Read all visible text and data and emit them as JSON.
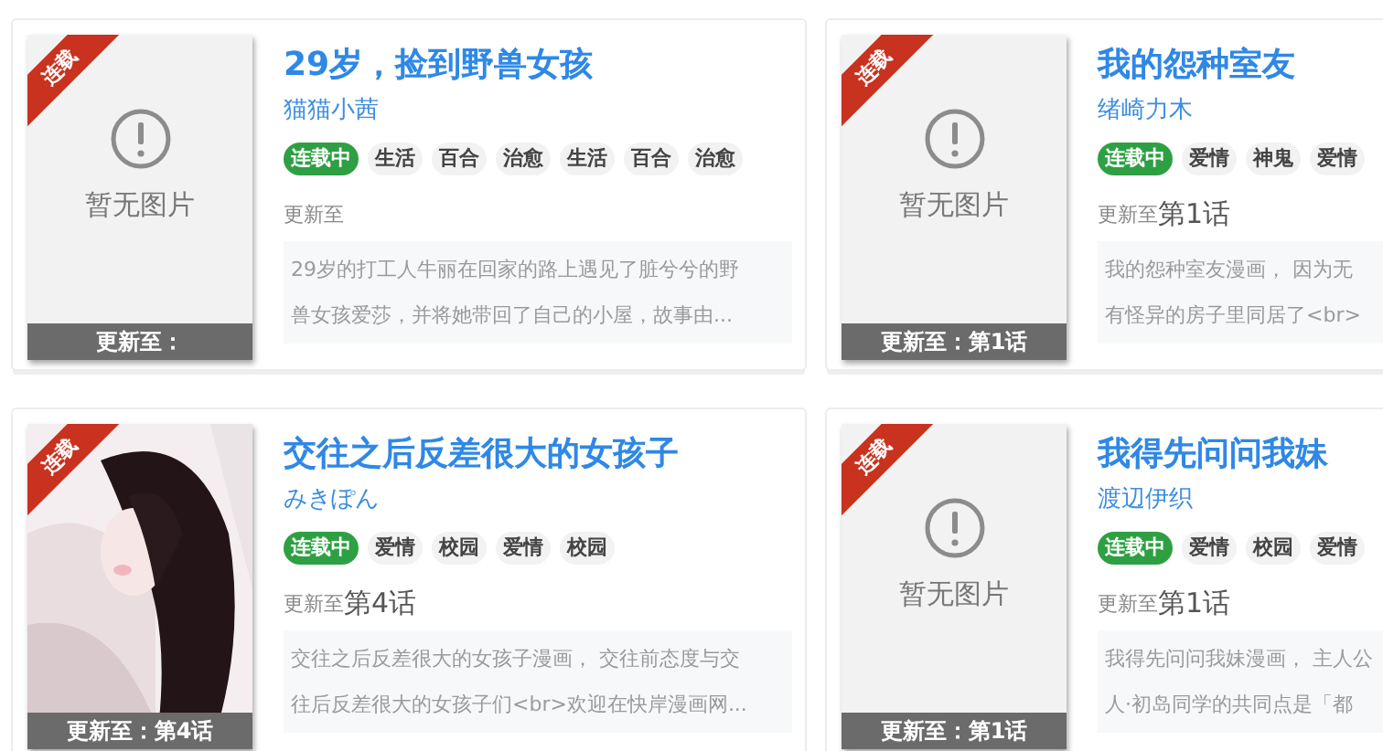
{
  "cards": [
    {
      "title": "29岁，捡到野兽女孩",
      "author": "猫猫小茜",
      "ribbon": "连载",
      "cover": {
        "kind": "placeholder",
        "text": "暂无图片"
      },
      "cover_caption": "更新至：",
      "tags": [
        {
          "kind": "status",
          "label": "连载中"
        },
        {
          "kind": "genre",
          "label": "生活"
        },
        {
          "kind": "genre",
          "label": "百合"
        },
        {
          "kind": "genre",
          "label": "治愈"
        },
        {
          "kind": "genre",
          "label": "生活"
        },
        {
          "kind": "genre",
          "label": "百合"
        },
        {
          "kind": "genre",
          "label": "治愈"
        }
      ],
      "update_label": "更新至",
      "description_lines": [
        "29岁的打工人牛丽在回家的路上遇见了脏兮兮的野",
        "兽女孩爱莎，并将她带回了自己的小屋，故事由..."
      ]
    },
    {
      "title": "我的怨种室友",
      "author": "绪崎力木",
      "ribbon": "连载",
      "cover": {
        "kind": "placeholder",
        "text": "暂无图片"
      },
      "cover_caption": "更新至：第1话",
      "tags": [
        {
          "kind": "status",
          "label": "连载中"
        },
        {
          "kind": "genre",
          "label": "爱情"
        },
        {
          "kind": "genre",
          "label": "神鬼"
        },
        {
          "kind": "genre",
          "label": "爱情"
        }
      ],
      "update_label": "更新至",
      "chapter": "第1话",
      "description_lines": [
        "我的怨种室友漫画， 因为无",
        "有怪异的房子里同居了<br>"
      ]
    },
    {
      "title": "交往之后反差很大的女孩子",
      "author": "みきぽん",
      "ribbon": "连载",
      "cover_caption": "更新至：第4话",
      "tags": [
        {
          "kind": "status",
          "label": "连载中"
        },
        {
          "kind": "genre",
          "label": "爱情"
        },
        {
          "kind": "genre",
          "label": "校园"
        },
        {
          "kind": "genre",
          "label": "爱情"
        },
        {
          "kind": "genre",
          "label": "校园"
        }
      ],
      "update_label": "更新至",
      "chapter": "第4话",
      "description_lines": [
        "交往之后反差很大的女孩子漫画， 交往前态度与交",
        "往后反差很大的女孩子们<br>欢迎在快岸漫画网..."
      ]
    },
    {
      "title": "我得先问问我妹",
      "author": "渡辺伊织",
      "ribbon": "连载",
      "cover": {
        "kind": "placeholder",
        "text": "暂无图片"
      },
      "cover_caption": "更新至：第1话",
      "tags": [
        {
          "kind": "status",
          "label": "连载中"
        },
        {
          "kind": "genre",
          "label": "爱情"
        },
        {
          "kind": "genre",
          "label": "校园"
        },
        {
          "kind": "genre",
          "label": "爱情"
        }
      ],
      "update_label": "更新至",
      "chapter": "第1话",
      "description_lines": [
        "我得先问问我妹漫画， 主人公",
        "人·初岛同学的共同点是「都"
      ]
    }
  ]
}
